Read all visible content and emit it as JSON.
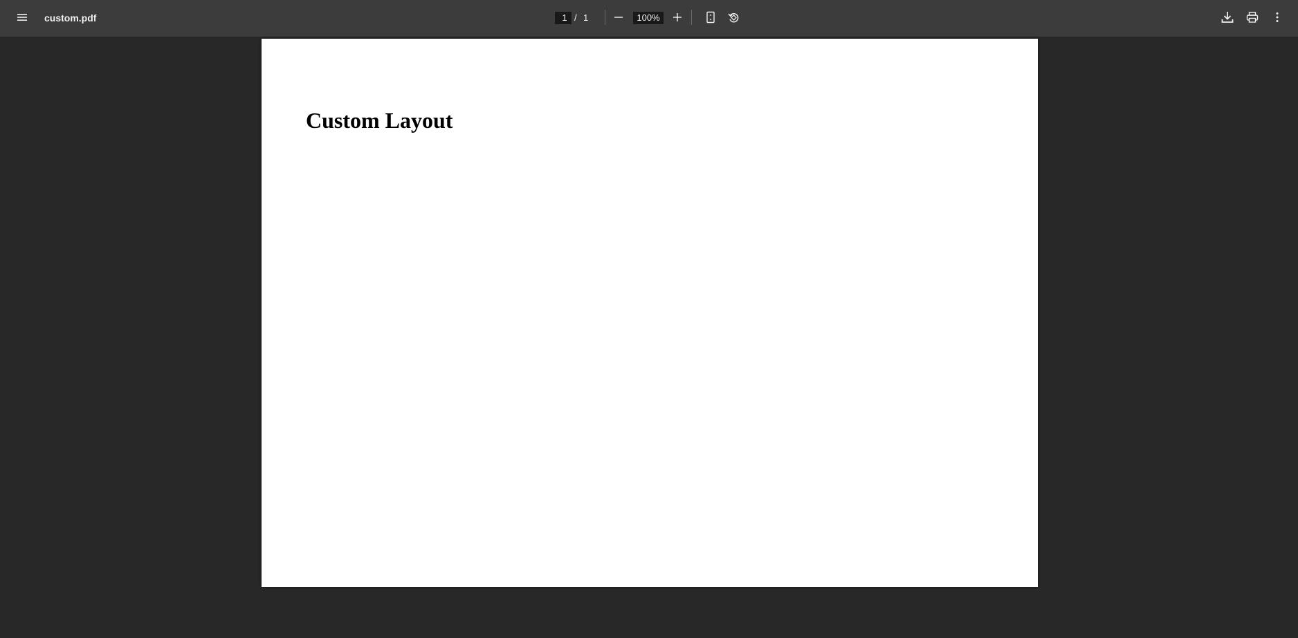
{
  "toolbar": {
    "menu_icon": "hamburger-menu-icon",
    "filename": "custom.pdf",
    "page": {
      "current": "1",
      "separator": "/",
      "total": "1"
    },
    "zoom": {
      "value": "100%",
      "zoom_out_icon": "minus-icon",
      "zoom_in_icon": "plus-icon"
    },
    "fit_icon": "fit-to-page-icon",
    "rotate_icon": "rotate-counterclockwise-icon",
    "download_icon": "download-icon",
    "print_icon": "print-icon",
    "more_icon": "more-vertical-icon"
  },
  "document": {
    "title": "Custom Layout"
  },
  "colors": {
    "toolbar_bg": "#3c3c3c",
    "viewer_bg": "#282828",
    "page_bg": "#ffffff",
    "input_bg": "#191919",
    "text": "#f1f1f1"
  }
}
